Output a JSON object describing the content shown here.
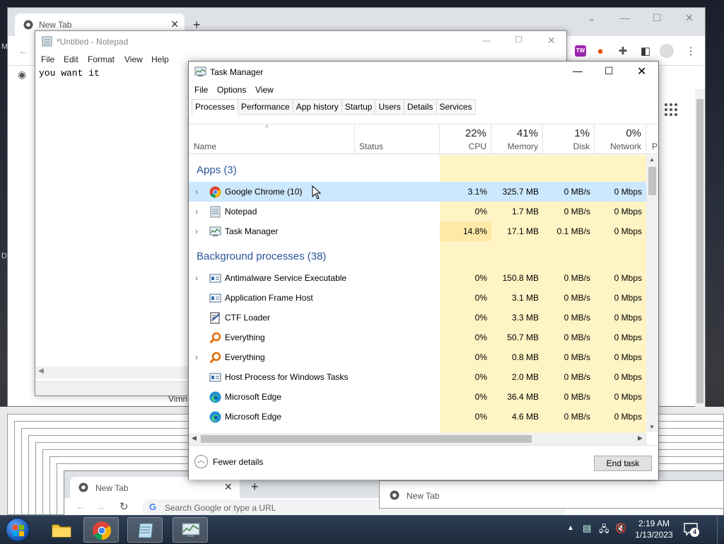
{
  "chrome_back": {
    "tab_title": "New Tab",
    "close_glyph": "✕",
    "new_tab_glyph": "+",
    "side_text_m": "M",
    "side_text_d": "D"
  },
  "notepad": {
    "title": "*Untitled - Notepad",
    "menu": [
      "File",
      "Edit",
      "Format",
      "View",
      "Help"
    ],
    "content": "you want it",
    "under_text": "Vimn"
  },
  "task_manager": {
    "title": "Task Manager",
    "menu": [
      "File",
      "Options",
      "View"
    ],
    "tabs": [
      "Processes",
      "Performance",
      "App history",
      "Startup",
      "Users",
      "Details",
      "Services"
    ],
    "columns": {
      "name": "Name",
      "status": "Status",
      "cpu": {
        "pct": "22%",
        "label": "CPU"
      },
      "memory": {
        "pct": "41%",
        "label": "Memory"
      },
      "disk": {
        "pct": "1%",
        "label": "Disk"
      },
      "network": {
        "pct": "0%",
        "label": "Network"
      },
      "power": "P"
    },
    "groups": {
      "apps": "Apps (3)",
      "background": "Background processes (38)"
    },
    "apps": [
      {
        "name": "Google Chrome (10)",
        "cpu": "3.1%",
        "memory": "325.7 MB",
        "disk": "0 MB/s",
        "network": "0 Mbps",
        "icon": "chrome-icon"
      },
      {
        "name": "Notepad",
        "cpu": "0%",
        "memory": "1.7 MB",
        "disk": "0 MB/s",
        "network": "0 Mbps",
        "icon": "notepad-icon"
      },
      {
        "name": "Task Manager",
        "cpu": "14.8%",
        "memory": "17.1 MB",
        "disk": "0.1 MB/s",
        "network": "0 Mbps",
        "icon": "task-manager-icon"
      }
    ],
    "background": [
      {
        "name": "Antimalware Service Executable",
        "cpu": "0%",
        "memory": "150.8 MB",
        "disk": "0 MB/s",
        "network": "0 Mbps",
        "expand": true,
        "icon": "service-icon"
      },
      {
        "name": "Application Frame Host",
        "cpu": "0%",
        "memory": "3.1 MB",
        "disk": "0 MB/s",
        "network": "0 Mbps",
        "expand": false,
        "icon": "service-icon"
      },
      {
        "name": "CTF Loader",
        "cpu": "0%",
        "memory": "3.3 MB",
        "disk": "0 MB/s",
        "network": "0 Mbps",
        "expand": false,
        "icon": "ctf-icon"
      },
      {
        "name": "Everything",
        "cpu": "0%",
        "memory": "50.7 MB",
        "disk": "0 MB/s",
        "network": "0 Mbps",
        "expand": false,
        "icon": "everything-icon"
      },
      {
        "name": "Everything",
        "cpu": "0%",
        "memory": "0.8 MB",
        "disk": "0 MB/s",
        "network": "0 Mbps",
        "expand": true,
        "icon": "everything-icon"
      },
      {
        "name": "Host Process for Windows Tasks",
        "cpu": "0%",
        "memory": "2.0 MB",
        "disk": "0 MB/s",
        "network": "0 Mbps",
        "expand": false,
        "icon": "service-icon"
      },
      {
        "name": "Microsoft Edge",
        "cpu": "0%",
        "memory": "36.4 MB",
        "disk": "0 MB/s",
        "network": "0 Mbps",
        "expand": false,
        "icon": "edge-icon"
      },
      {
        "name": "Microsoft Edge",
        "cpu": "0%",
        "memory": "4.6 MB",
        "disk": "0 MB/s",
        "network": "0 Mbps",
        "expand": false,
        "icon": "edge-icon"
      }
    ],
    "fewer_details": "Fewer details",
    "end_task": "End task"
  },
  "chrome_front": {
    "tab_title": "New Tab",
    "omnibox_placeholder": "Search Google or type a URL",
    "tab2_title": "New Tab"
  },
  "taskbar": {
    "time": "2:19 AM",
    "date": "1/13/2023",
    "notification_count": "4"
  },
  "colors": {
    "selected_row": "#cce8ff",
    "group_header": "#2a5598",
    "heat_light": "#fff4c4",
    "heat_medium": "#ffe9a8"
  }
}
